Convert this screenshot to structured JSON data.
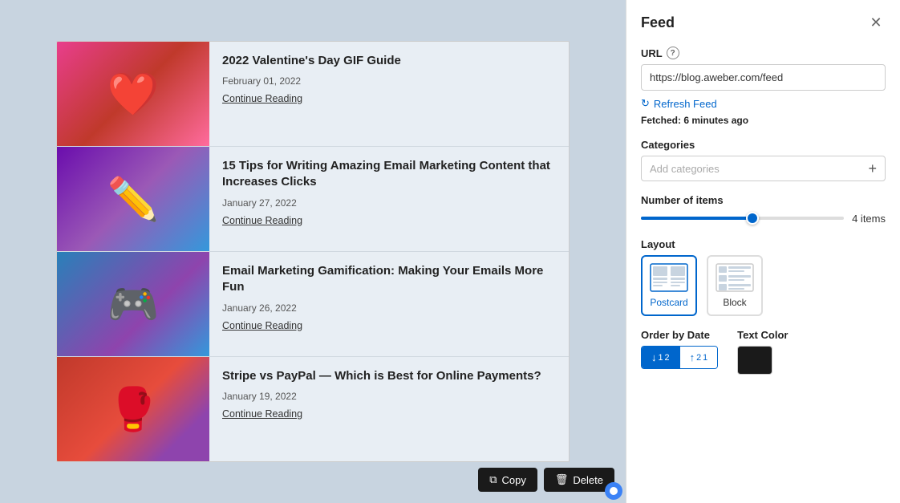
{
  "left_panel": {
    "items": [
      {
        "title": "2022 Valentine's Day GIF Guide",
        "date": "February 01, 2022",
        "link_text": "Continue Reading",
        "image_class": "img1",
        "image_emoji": "❤️"
      },
      {
        "title": "15 Tips for Writing Amazing Email Marketing Content that Increases Clicks",
        "date": "January 27, 2022",
        "link_text": "Continue Reading",
        "image_class": "img2",
        "image_emoji": "✏️"
      },
      {
        "title": "Email Marketing Gamification: Making Your Emails More Fun",
        "date": "January 26, 2022",
        "link_text": "Continue Reading",
        "image_class": "img3",
        "image_emoji": "🎮"
      },
      {
        "title": "Stripe vs PayPal — Which is Best for Online Payments?",
        "date": "January 19, 2022",
        "link_text": "Continue Reading",
        "image_class": "img4",
        "image_emoji": "🥊"
      }
    ],
    "toolbar": {
      "copy_label": "Copy",
      "delete_label": "Delete"
    }
  },
  "right_panel": {
    "title": "Feed",
    "url_label": "URL",
    "url_value": "https://blog.aweber.com/feed",
    "url_placeholder": "https://blog.aweber.com/feed",
    "refresh_label": "Refresh Feed",
    "fetched_prefix": "Fetched:",
    "fetched_value": "6 minutes ago",
    "categories_label": "Categories",
    "categories_placeholder": "Add categories",
    "number_items_label": "Number of items",
    "items_count": "4 items",
    "layout_label": "Layout",
    "layout_options": [
      {
        "id": "postcard",
        "label": "Postcard",
        "active": true
      },
      {
        "id": "block",
        "label": "Block",
        "active": false
      }
    ],
    "order_label": "Order by Date",
    "text_color_label": "Text Color",
    "sort_options": [
      {
        "label": "↓ 1→2",
        "active": true
      },
      {
        "label": "↑ 2→1",
        "active": false
      }
    ]
  }
}
